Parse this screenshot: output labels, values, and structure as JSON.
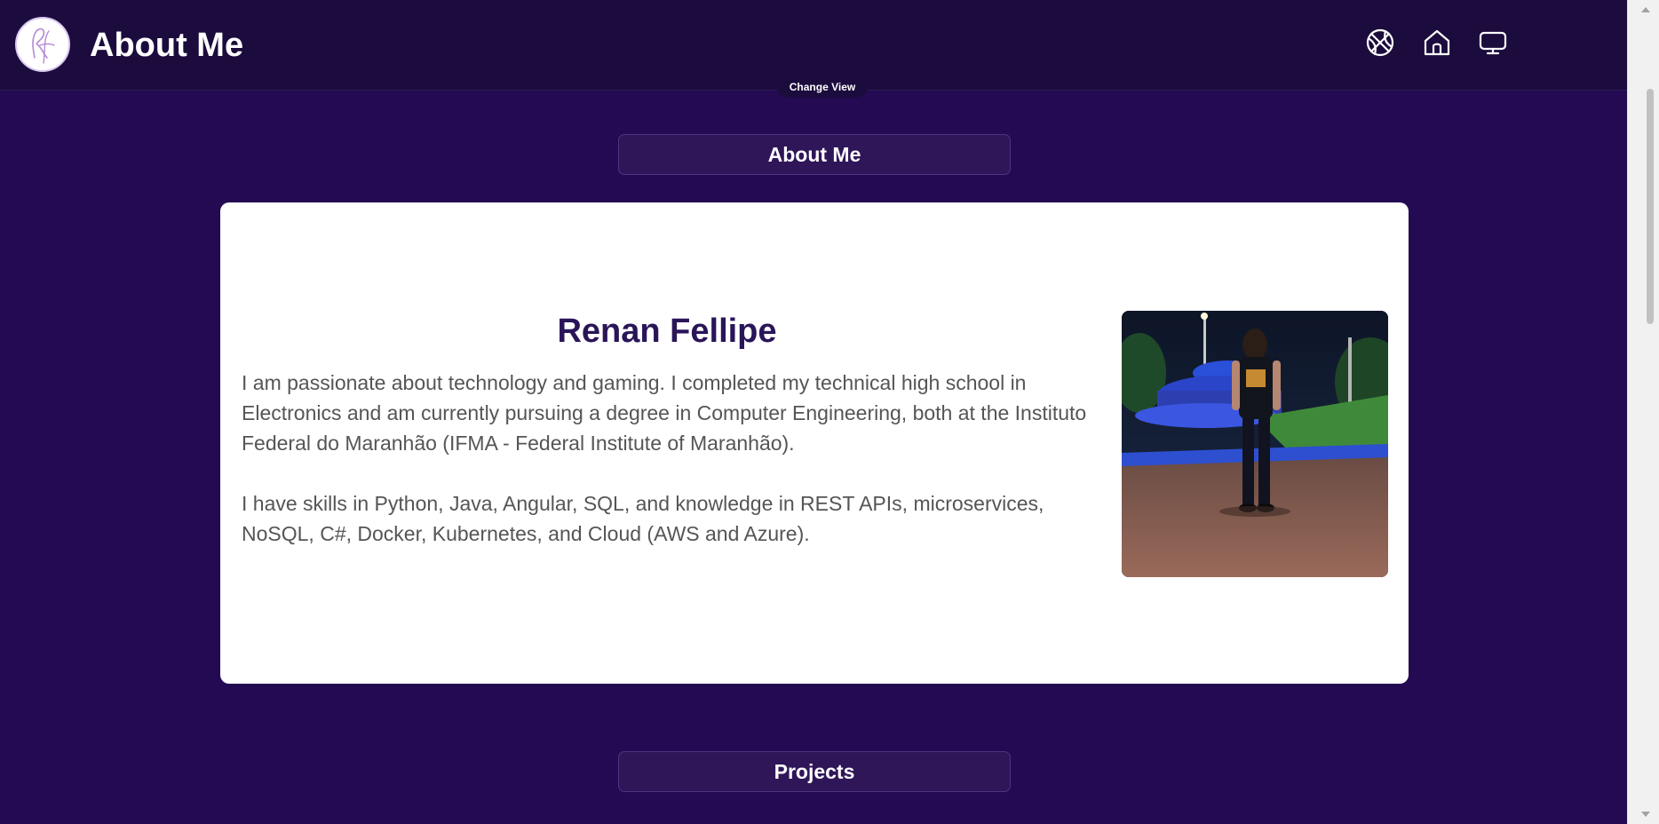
{
  "header": {
    "title": "About Me",
    "logo_icon": "signature-logo-icon",
    "nav_icons": [
      "basketball-icon",
      "home-icon",
      "monitor-icon"
    ],
    "change_view_label": "Change View"
  },
  "about_section": {
    "heading": "About Me",
    "name": "Renan Fellipe",
    "bio": [
      "I am passionate about technology and gaming. I completed my technical high school in Electronics and am currently pursuing a degree in Computer Engineering, both at the Instituto Federal do Maranhão (IFMA - Federal Institute of Maranhão).",
      "I have skills in Python, Java, Angular, SQL, and knowledge in REST APIs, microservices, NoSQL, C#, Docker, Kubernetes, and Cloud (AWS and Azure)."
    ]
  },
  "projects_section": {
    "heading": "Projects"
  },
  "colors": {
    "page_background": "#230a52",
    "header_background": "#1c0c3d",
    "pill_background": "#2f1658",
    "name_color": "#2a1559",
    "text_color": "#555555"
  }
}
